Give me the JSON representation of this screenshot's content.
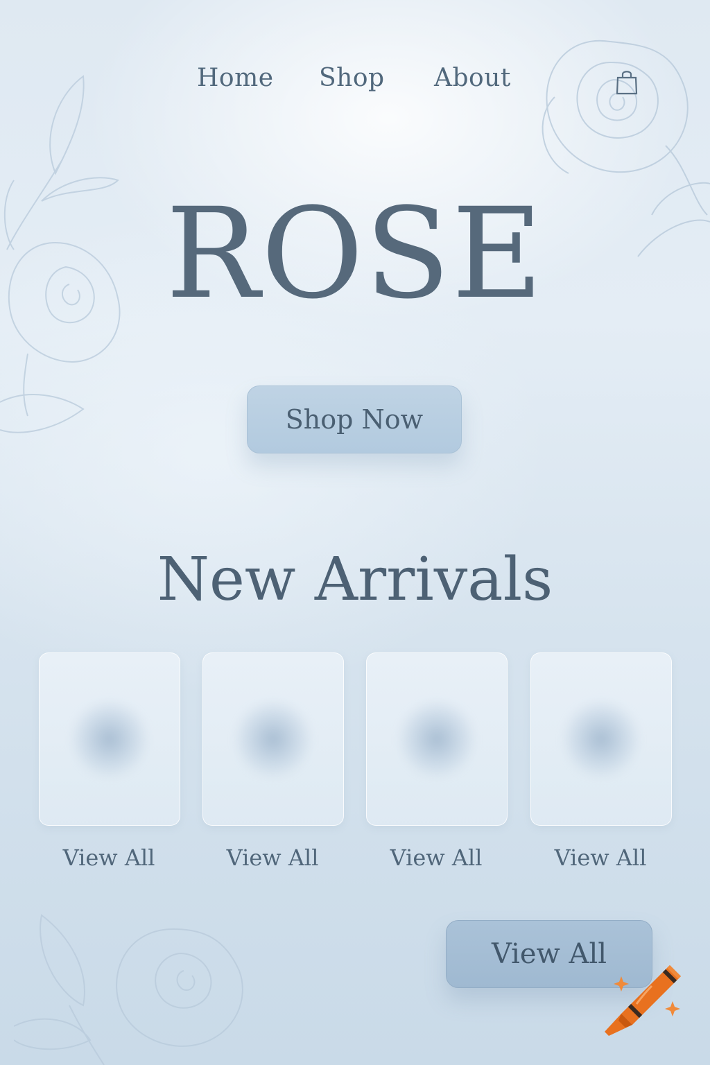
{
  "nav": {
    "links": [
      "Home",
      "Shop",
      "About"
    ],
    "cart_icon": "shopping-bag-icon"
  },
  "hero": {
    "title": "ROSE",
    "cta_label": "Shop Now"
  },
  "new_arrivals": {
    "title": "New Arrivals",
    "products": [
      {
        "link_label": "View All"
      },
      {
        "link_label": "View All"
      },
      {
        "link_label": "View All"
      },
      {
        "link_label": "View All"
      }
    ],
    "view_all_button": "View All"
  },
  "badge_icon": "crayon-icon",
  "colors": {
    "text": "#4d6174",
    "button": "#b2cadf",
    "button_dark": "#9fb9d1",
    "accent": "#e8711f"
  }
}
